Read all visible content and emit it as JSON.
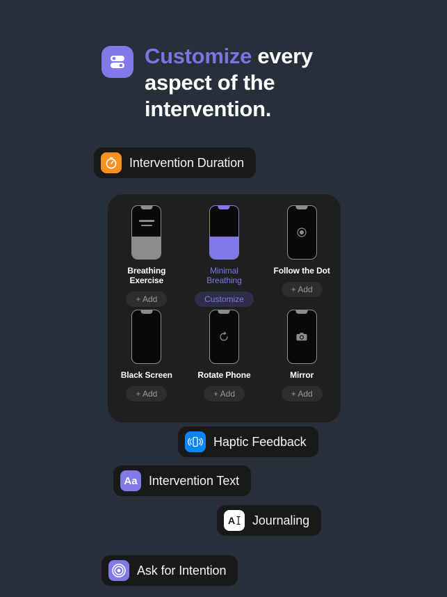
{
  "colors": {
    "background": "#282e3a",
    "card": "#1f1f1f",
    "pill": "#191919",
    "accent_purple": "#8179e8",
    "title_accent": "#7b74e0",
    "orange": "#f5921e",
    "blue": "#0a84ff",
    "gray": "#8c8c8c"
  },
  "header": {
    "icon": "toggles-icon",
    "title_accent": "Customize",
    "title_rest": " every aspect of the intervention."
  },
  "features": [
    {
      "id": "intervention-duration",
      "label": "Intervention Duration",
      "icon": "timer-icon",
      "icon_color": "#f5921e"
    },
    {
      "id": "haptic-feedback",
      "label": "Haptic Feedback",
      "icon": "vibrate-phone-icon",
      "icon_color": "#0a84ff"
    },
    {
      "id": "intervention-text",
      "label": "Intervention Text",
      "icon": "aa-text-icon",
      "icon_color": "#8179e8",
      "icon_text": "Aa"
    },
    {
      "id": "journaling",
      "label": "Journaling",
      "icon": "text-cursor-icon",
      "icon_color": "#ffffff"
    },
    {
      "id": "ask-for-intention",
      "label": "Ask for Intention",
      "icon": "target-icon",
      "icon_color": "#8179e8"
    }
  ],
  "interventions": [
    {
      "name": "Breathing Exercise",
      "preview": "breathing-bars",
      "selected": false,
      "action": "+ Add"
    },
    {
      "name": "Minimal Breathing",
      "preview": "minimal-fill",
      "selected": true,
      "action": "Customize"
    },
    {
      "name": "Follow the Dot",
      "preview": "dot",
      "selected": false,
      "action": "+ Add"
    },
    {
      "name": "Black Screen",
      "preview": "blank",
      "selected": false,
      "action": "+ Add"
    },
    {
      "name": "Rotate Phone",
      "preview": "rotate",
      "selected": false,
      "action": "+ Add"
    },
    {
      "name": "Mirror",
      "preview": "camera",
      "selected": false,
      "action": "+ Add"
    }
  ]
}
